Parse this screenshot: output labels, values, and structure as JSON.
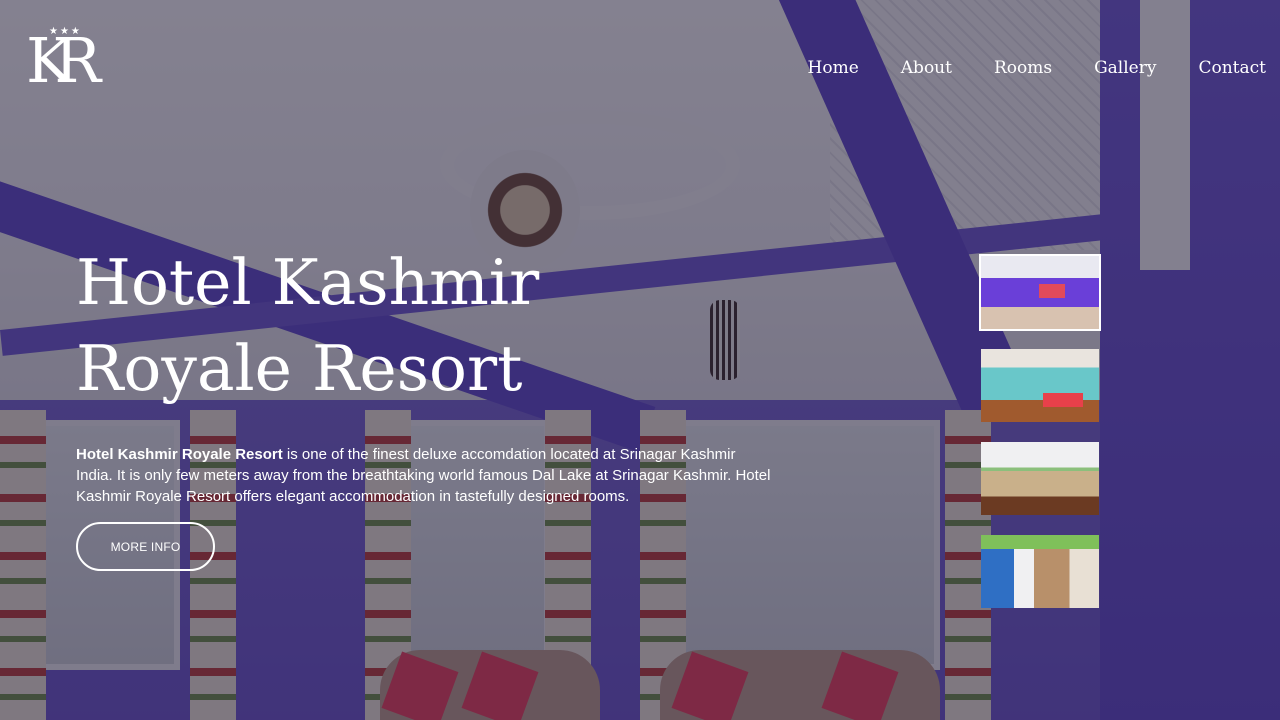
{
  "logo": {
    "stars": "★★★",
    "mark": "KR"
  },
  "nav": {
    "items": [
      "Home",
      "About",
      "Rooms",
      "Gallery",
      "Contact"
    ]
  },
  "hero": {
    "title_line1": "Hotel Kashmir",
    "title_line2": "Royale Resort",
    "description_bold": "Hotel Kashmir Royale Resort",
    "description_rest": " is one of the finest deluxe accomdation located at Srinagar Kashmir India. It is only few meters away from the breathtaking world famous Dal Lake at Srinagar Kashmir. Hotel Kashmir Royale Resort offers elegant accommodation in tastefully designed rooms.",
    "button_label": "MORE INFO"
  },
  "thumbnails": {
    "count": 4,
    "active_index": 0
  },
  "colors": {
    "accent_purple": "#6651c9",
    "text": "#ffffff"
  }
}
